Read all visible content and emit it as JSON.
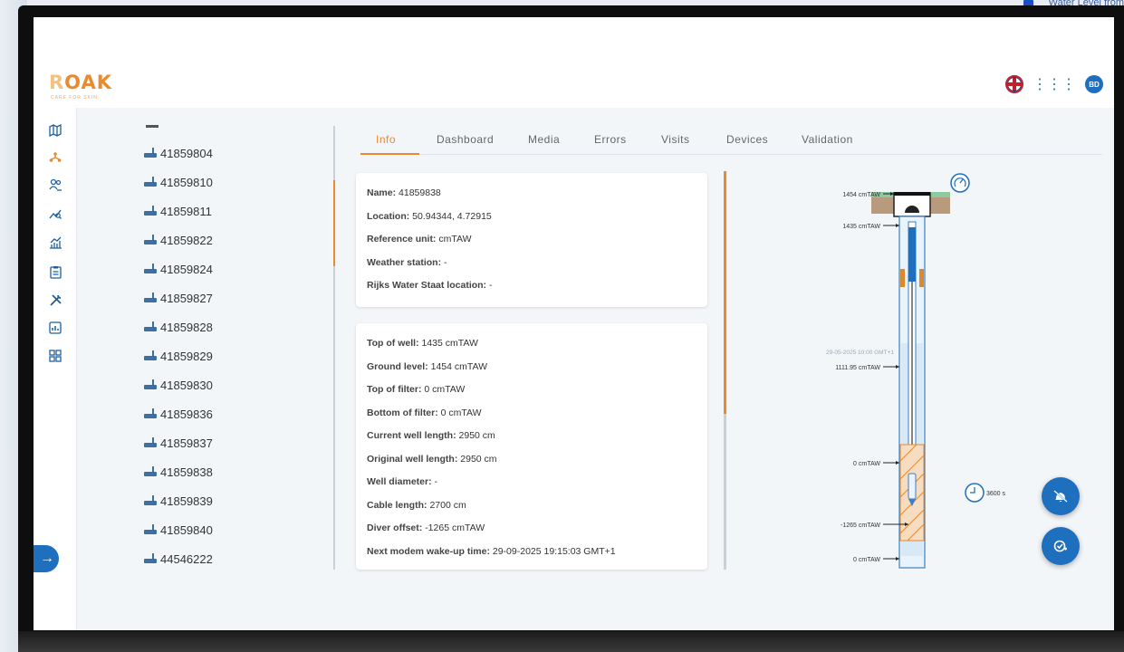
{
  "backdrop": {
    "corner_text": "Water Level from"
  },
  "app": {
    "logo": "ROAK",
    "logo_tagline": "CARE FOR SKIN",
    "avatar_initials": "BD"
  },
  "rail": [
    "map-icon",
    "network-icon",
    "users-icon",
    "trend-icon",
    "chart-icon",
    "clipboard-icon",
    "tools-icon",
    "report-icon",
    "grid-icon"
  ],
  "wells": [
    "41859804",
    "41859810",
    "41859811",
    "41859822",
    "41859824",
    "41859827",
    "41859828",
    "41859829",
    "41859830",
    "41859836",
    "41859837",
    "41859838",
    "41859839",
    "41859840",
    "44546222"
  ],
  "tabs": [
    "Info",
    "Dashboard",
    "Media",
    "Errors",
    "Visits",
    "Devices",
    "Validation"
  ],
  "active_tab": "Info",
  "info_card": [
    {
      "key": "Name:",
      "value": "41859838"
    },
    {
      "key": "Location:",
      "value": "50.94344, 4.72915"
    },
    {
      "key": "Reference unit:",
      "value": "cmTAW"
    },
    {
      "key": "Weather station:",
      "value": "-"
    },
    {
      "key": "Rijks Water Staat location:",
      "value": "-"
    }
  ],
  "well_card": [
    {
      "key": "Top of well:",
      "value": "1435 cmTAW"
    },
    {
      "key": "Ground level:",
      "value": "1454 cmTAW"
    },
    {
      "key": "Top of filter:",
      "value": "0 cmTAW"
    },
    {
      "key": "Bottom of filter:",
      "value": "0 cmTAW"
    },
    {
      "key": "Current well length:",
      "value": "2950 cm"
    },
    {
      "key": "Original well length:",
      "value": "2950 cm"
    },
    {
      "key": "Well diameter:",
      "value": "-"
    },
    {
      "key": "Cable length:",
      "value": "2700 cm"
    },
    {
      "key": "Diver offset:",
      "value": "-1265 cmTAW"
    },
    {
      "key": "Next modem wake-up time:",
      "value": "29-09-2025 19:15:03 GMT+1"
    }
  ],
  "diagram": {
    "ground_label": "1454 cmTAW",
    "top_label": "1435 cmTAW",
    "timestamp": "29-05-2025 10:00 GMT+1",
    "water_label": "1111.95 cmTAW",
    "filter_top_label": "0 cmTAW",
    "diver_label": "-1265 cmTAW",
    "filter_bottom_label": "0 cmTAW",
    "interval": "3600 s"
  },
  "colors": {
    "accent": "#e98a2f",
    "primary": "#1f6fbf"
  }
}
